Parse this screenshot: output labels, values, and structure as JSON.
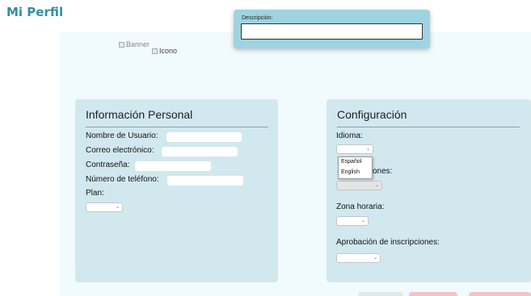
{
  "page": {
    "title": "Mi Perfil"
  },
  "profile": {
    "banner_alt": "Banner",
    "icon_alt": "Icono"
  },
  "description_popup": {
    "label": "Descripción:",
    "value": ""
  },
  "personal_info": {
    "title": "Información Personal",
    "fields": {
      "username": {
        "label": "Nombre de Usuario:",
        "value": ""
      },
      "email": {
        "label": "Correo electrónico:",
        "value": ""
      },
      "password": {
        "label": "Contraseña:",
        "value": ""
      },
      "phone": {
        "label": "Número de teléfono:",
        "value": ""
      }
    },
    "plan": {
      "label": "Plan:",
      "selected": ""
    }
  },
  "settings": {
    "title": "Configuración",
    "language": {
      "label": "Idioma:",
      "selected": "",
      "options": [
        "Español",
        "English"
      ]
    },
    "notifications": {
      "label_visible_part": "ones:",
      "selected": ""
    },
    "timezone": {
      "label": "Zona horaria:",
      "selected": ""
    },
    "enrollment_approval": {
      "label": "Aprobación de inscripciones:",
      "selected": ""
    }
  },
  "colors": {
    "title": "#2f8fa3",
    "card_bg": "#d2e8ef",
    "page_bg": "#f1fafd",
    "popup_bg": "#9fd3e2",
    "bottom_button_gray": "#e3e8ea",
    "bottom_button_red": "#f4c4c4"
  }
}
